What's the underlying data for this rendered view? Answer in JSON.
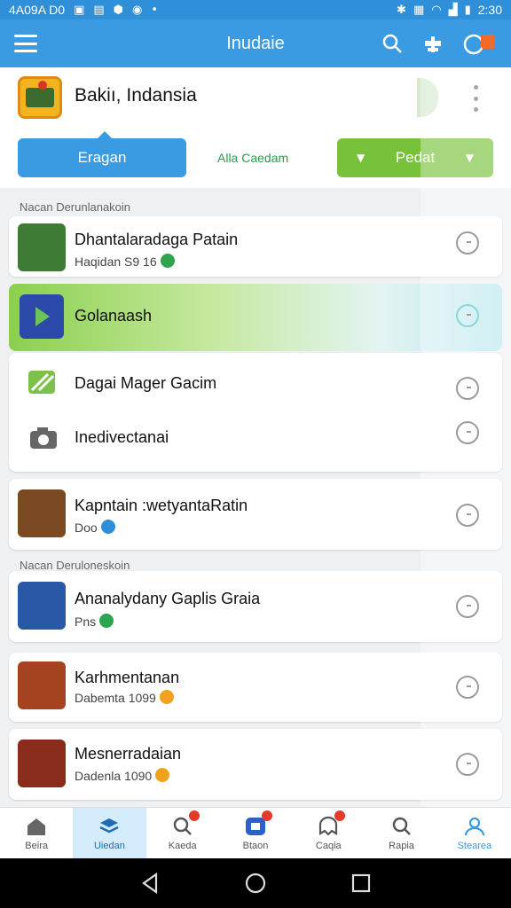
{
  "status_bar": {
    "left_text": "4A09A D0",
    "time": "2:30"
  },
  "app_bar": {
    "title": "Inudaie"
  },
  "header": {
    "title": "Bakiı, Indansia"
  },
  "tabs": {
    "primary": "Eragan",
    "link": "Alla Caedam",
    "secondary": "Pedat"
  },
  "sections": [
    {
      "label": "Nacan Derunlanakoin"
    },
    {
      "label": "Nacan Deruloneskoin"
    }
  ],
  "rows": [
    {
      "title": "Dhantalaradaga Patain",
      "subtitle": "Haqidan S9 16",
      "badge_color": "#2ea44f"
    },
    {
      "title": "Golanaash",
      "subtitle": ""
    },
    {
      "title": "Dagai Mager Gacim",
      "subtitle": ""
    },
    {
      "title": "Inedivectanai",
      "subtitle": ""
    },
    {
      "title": "Kapntain :wetyantaRatin",
      "subtitle": "Doo",
      "badge_color": "#2f8fd8"
    },
    {
      "title": "Ananalydany Gaplis Graia",
      "subtitle": "Pns",
      "badge_color": "#2ea44f"
    },
    {
      "title": "Karhmentanan",
      "subtitle": "Dabemta 1099",
      "badge_color": "#f0a21e"
    },
    {
      "title": "Mesnerradaian",
      "subtitle": "Dadenla 1090",
      "badge_color": "#f0a21e"
    }
  ],
  "bottom_nav": [
    {
      "label": "Beira"
    },
    {
      "label": "Uiedan"
    },
    {
      "label": "Kaeda"
    },
    {
      "label": "Btaon"
    },
    {
      "label": "Caqia"
    },
    {
      "label": "Rapia"
    },
    {
      "label": "Stearea"
    }
  ],
  "colors": {
    "primary": "#3a9be2",
    "accent_green": "#77c23a",
    "nav_active": "#d3ebfa"
  }
}
